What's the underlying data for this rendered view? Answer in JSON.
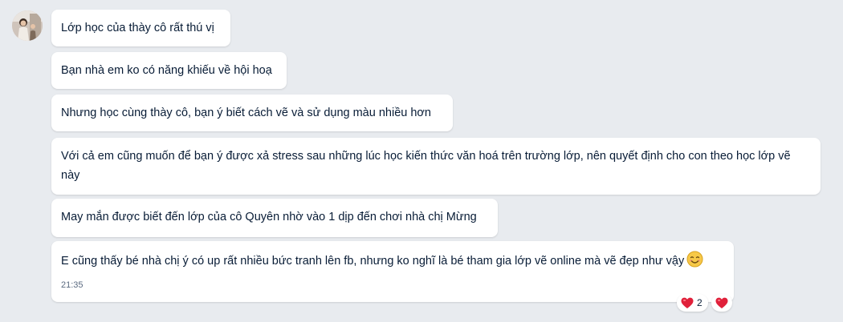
{
  "messages": [
    {
      "text": "Lớp học của thày cô rất thú vị"
    },
    {
      "text": "Bạn nhà em ko có năng khiếu về hội hoạ"
    },
    {
      "text": "Nhưng học cùng thày cô, bạn ý biết cách vẽ và sử dụng màu nhiều hơn"
    },
    {
      "text": "Với cả em cũng muốn để bạn ý được xả stress sau những lúc học kiến thức văn hoá trên trường lớp, nên quyết định cho con theo học lớp vẽ này"
    },
    {
      "text": "May mắn được biết đến lớp của cô Quyên nhờ vào 1 dịp đến chơi nhà chị Mừng"
    },
    {
      "text": "E cũng thấy bé nhà chị ý có up rất nhiều bức tranh lên fb, nhưng ko nghĩ là bé tham gia lớp vẽ online mà vẽ đẹp như vậy",
      "emoji": "smiling-face-icon",
      "time": "21:35"
    }
  ],
  "reactions": [
    {
      "icon": "heart-icon",
      "count": "2"
    },
    {
      "icon": "heart-icon"
    }
  ],
  "colors": {
    "background": "#e8ebef",
    "bubble": "#ffffff",
    "text": "#081c36",
    "heart": "#e0203a"
  }
}
